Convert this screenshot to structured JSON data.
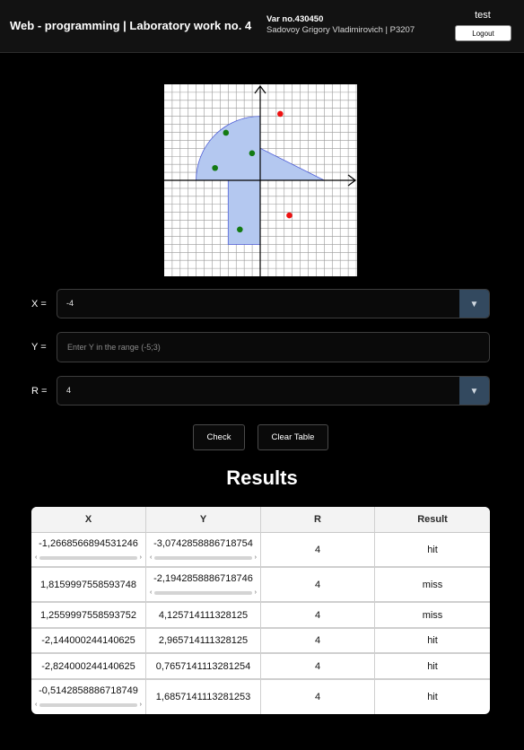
{
  "header": {
    "title": "Web - programming | Laboratory work no. 4",
    "variant": "Var no.430450",
    "student": "Sadovoy Grigory Vladimirovich | P3207",
    "username": "test",
    "logout_label": "Logout"
  },
  "graph": {
    "r": 4,
    "area_color": "#b4c8f0",
    "points": [
      {
        "x": 1.25,
        "y": 4.15,
        "hit": false
      },
      {
        "x": -2.14,
        "y": 2.97,
        "hit": true
      },
      {
        "x": -0.51,
        "y": 1.69,
        "hit": true
      },
      {
        "x": -2.82,
        "y": 0.77,
        "hit": true
      },
      {
        "x": 1.82,
        "y": -2.19,
        "hit": false
      },
      {
        "x": -1.27,
        "y": -3.07,
        "hit": true
      }
    ]
  },
  "form": {
    "x_label": "X =",
    "x_value": "-4",
    "y_label": "Y =",
    "y_placeholder": "Enter Y in the range (-5;3)",
    "r_label": "R =",
    "r_value": "4",
    "check_label": "Check",
    "clear_label": "Clear Table"
  },
  "results": {
    "title": "Results",
    "columns": [
      "X",
      "Y",
      "R",
      "Result"
    ],
    "rows": [
      {
        "x": "-1,2668566894531246",
        "y": "-3,0742858886718754",
        "r": "4",
        "result": "hit"
      },
      {
        "x": "1,8159997558593748",
        "y": "-2,1942858886718746",
        "r": "4",
        "result": "miss"
      },
      {
        "x": "1,2559997558593752",
        "y": "4,125714111328125",
        "r": "4",
        "result": "miss"
      },
      {
        "x": "-2,144000244140625",
        "y": "2,965714111328125",
        "r": "4",
        "result": "hit"
      },
      {
        "x": "-2,824000244140625",
        "y": "0,7657141113281254",
        "r": "4",
        "result": "hit"
      },
      {
        "x": "-0,5142858886718749",
        "y": "1,6857141113281253",
        "r": "4",
        "result": "hit"
      }
    ]
  },
  "colors": {
    "hit": "#1f8a1f",
    "miss": "#e02020",
    "select_arrow_bg": "#33495f"
  }
}
